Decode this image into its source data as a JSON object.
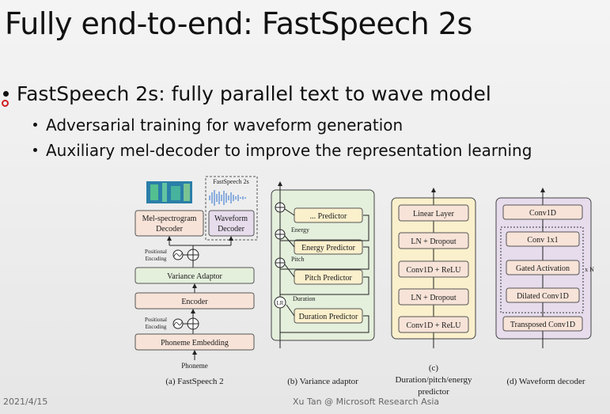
{
  "slide": {
    "title": "Fully end-to-end: FastSpeech 2s",
    "bullets": [
      "FastSpeech 2s: fully parallel text to wave model",
      "Adversarial training for waveform generation",
      "Auxiliary mel-decoder to improve the representation learning"
    ],
    "date": "2021/4/15",
    "author": "Xu Tan @ Microsoft Research Asia"
  },
  "figure": {
    "a": {
      "caption": "(a) FastSpeech 2",
      "input": "Phoneme",
      "blocks": [
        "Phoneme Embedding",
        "Encoder",
        "Variance Adaptor"
      ],
      "positional_encoding": [
        "Positional",
        "Encoding"
      ],
      "mel_decoder": [
        "Mel-spectrogram",
        "Decoder"
      ],
      "wave_decoder": [
        "Waveform",
        "Decoder"
      ],
      "fs2s_label": "FastSpeech 2s"
    },
    "b": {
      "caption": "(b) Variance adaptor",
      "predictors": [
        "Duration Predictor",
        "Pitch Predictor",
        "Energy Predictor",
        "... Predictor"
      ],
      "side_labels": [
        "Duration",
        "Pitch",
        "Energy"
      ],
      "lr": "LR"
    },
    "c": {
      "caption": [
        "(c)",
        "Duration/pitch/energy",
        "predictor"
      ],
      "layers": [
        "Conv1D + ReLU",
        "LN + Dropout",
        "Conv1D + ReLU",
        "LN + Dropout",
        "Linear Layer"
      ]
    },
    "d": {
      "caption": "(d) Waveform decoder",
      "layers": [
        "Transposed Conv1D",
        "Dilated Conv1D",
        "Gated Activation",
        "Conv 1x1",
        "Conv1D"
      ],
      "repeat": "x N"
    }
  },
  "colors": {
    "peach": "#f7e3d8",
    "green": "#e4efdc",
    "yellow": "#fbf0cc",
    "lavender": "#e6dcec"
  }
}
